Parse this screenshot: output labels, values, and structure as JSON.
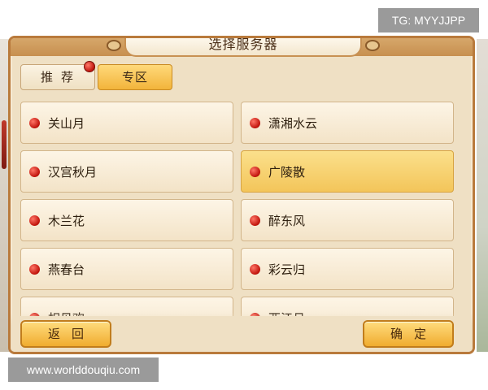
{
  "watermarks": {
    "tg": "TG: MYYJJPP",
    "site": "www.worlddouqiu.com"
  },
  "dialog": {
    "title": "选择服务器"
  },
  "tabs": [
    {
      "label": "推荐",
      "active": false,
      "has_notification": true
    },
    {
      "label": "专区",
      "active": true
    }
  ],
  "servers": [
    {
      "name": "关山月",
      "selected": false
    },
    {
      "name": "潇湘水云",
      "selected": false
    },
    {
      "name": "汉宫秋月",
      "selected": false
    },
    {
      "name": "广陵散",
      "selected": true
    },
    {
      "name": "木兰花",
      "selected": false
    },
    {
      "name": "醉东风",
      "selected": false
    },
    {
      "name": "燕春台",
      "selected": false
    },
    {
      "name": "彩云归",
      "selected": false
    },
    {
      "name": "相见欢",
      "selected": false
    },
    {
      "name": "西江月",
      "selected": false
    }
  ],
  "buttons": {
    "back": "返回",
    "confirm": "确定"
  },
  "colors": {
    "selected_item": "#f3c55a",
    "status_dot": "#c1150d",
    "panel_border": "#b97a3c"
  }
}
